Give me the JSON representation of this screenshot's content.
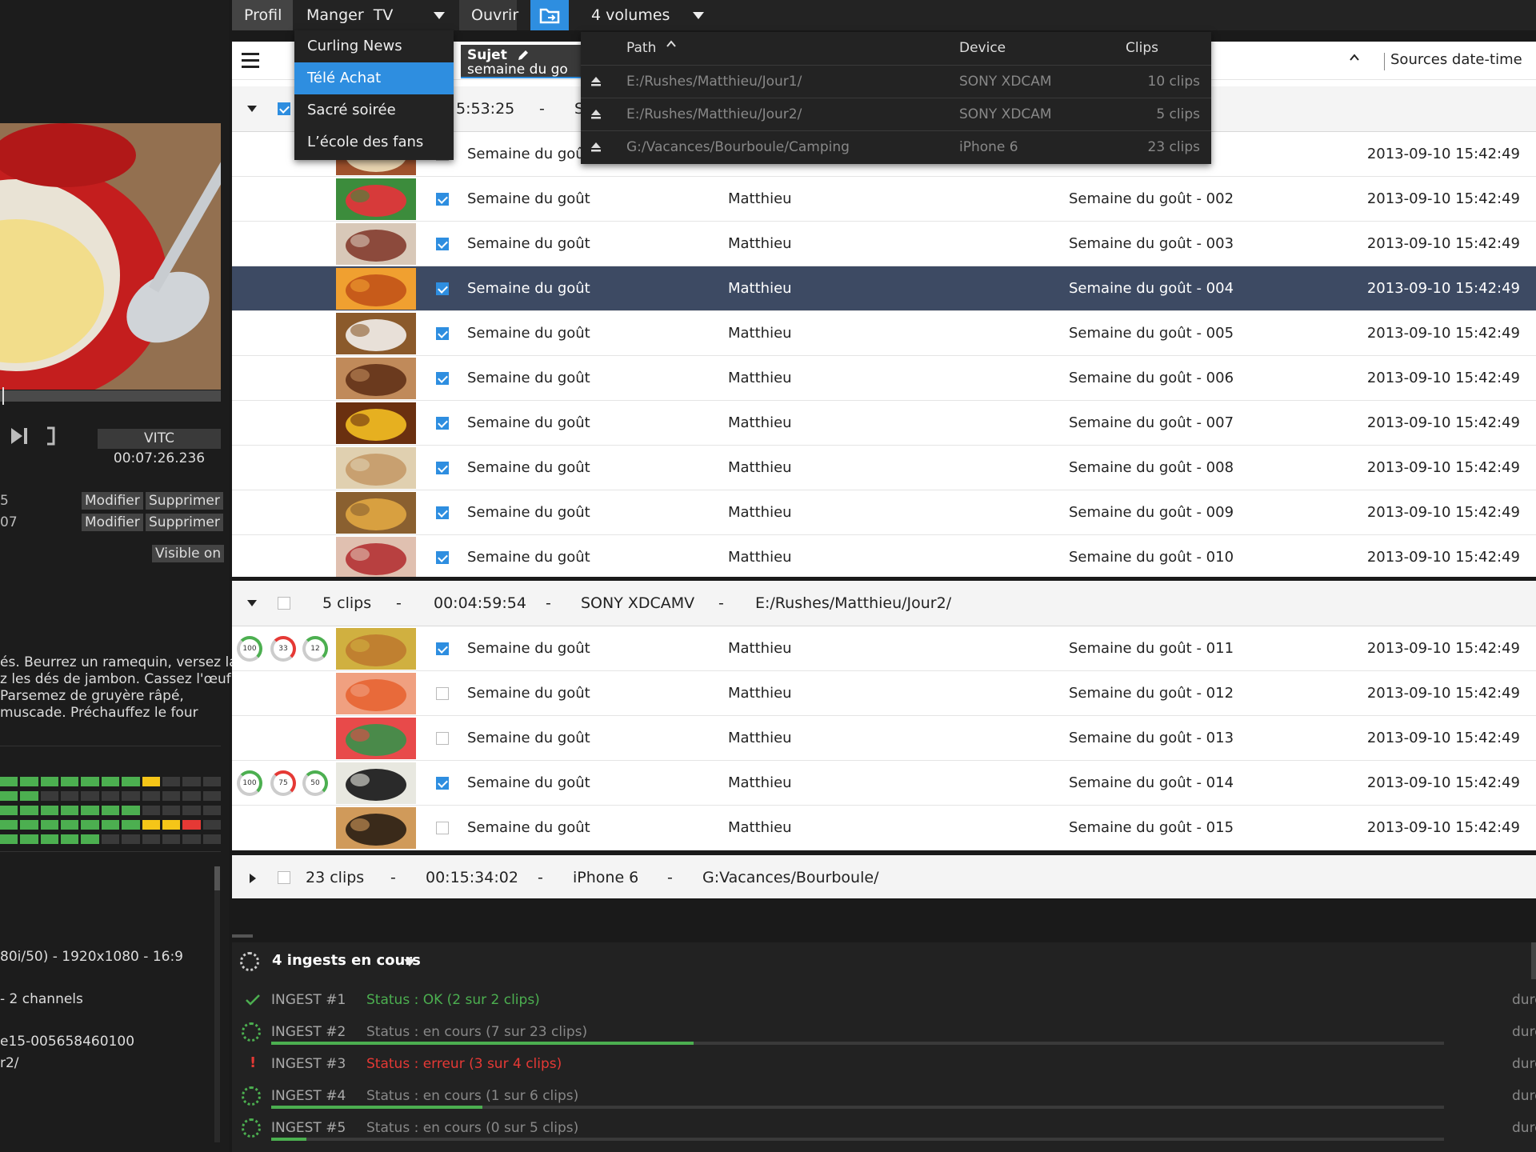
{
  "topbar": {
    "profil": "Profil",
    "profile_selected": "Manger  TV",
    "ouvrir": "Ouvrir",
    "volumes": "4 volumes"
  },
  "profile_menu": [
    "Curling News",
    "Télé Achat",
    "Sacré soirée",
    "L’école des fans"
  ],
  "profile_menu_active": 1,
  "volumes_panel": {
    "headers": {
      "path": "Path",
      "device": "Device",
      "clips": "Clips"
    },
    "rows": [
      {
        "path": "E:/Rushes/Matthieu/Jour1/",
        "device": "SONY XDCAM",
        "clips": "10 clips"
      },
      {
        "path": "E:/Rushes/Matthieu/Jour2/",
        "device": "SONY XDCAM",
        "clips": "5 clips"
      },
      {
        "path": "G:/Vacances/Bourboule/Camping",
        "device": "iPhone 6",
        "clips": "23 clips"
      }
    ]
  },
  "table_header": {
    "subject_label": "Sujet",
    "subject_value": "semaine du go",
    "sort_col": "Sources date-time"
  },
  "groups": [
    {
      "time_partial": "5:53:25",
      "dash": "-",
      "partial_letter": "S"
    },
    {
      "clips": "5 clips",
      "dash": "-",
      "duration": "00:04:59:54",
      "device": "SONY XDCAMV",
      "path": "E:/Rushes/Matthieu/Jour2/"
    },
    {
      "clips": "23 clips",
      "dash": "-",
      "duration": "00:15:34:02",
      "device": "iPhone 6",
      "path": "G:Vacances/Bourboule/"
    }
  ],
  "rows_group1": [
    {
      "subject": "Semaine du goût",
      "author": "",
      "name": "",
      "date": "2013-09-10 15:42:49",
      "checked": false
    },
    {
      "subject": "Semaine du goût",
      "author": "Matthieu",
      "name": "Semaine du goût - 002",
      "date": "2013-09-10 15:42:49",
      "checked": true
    },
    {
      "subject": "Semaine du goût",
      "author": "Matthieu",
      "name": "Semaine du goût - 003",
      "date": "2013-09-10 15:42:49",
      "checked": true
    },
    {
      "subject": "Semaine du goût",
      "author": "Matthieu",
      "name": "Semaine du goût - 004",
      "date": "2013-09-10 15:42:49",
      "checked": true
    },
    {
      "subject": "Semaine du goût",
      "author": "Matthieu",
      "name": "Semaine du goût - 005",
      "date": "2013-09-10 15:42:49",
      "checked": true
    },
    {
      "subject": "Semaine du goût",
      "author": "Matthieu",
      "name": "Semaine du goût - 006",
      "date": "2013-09-10 15:42:49",
      "checked": true
    },
    {
      "subject": "Semaine du goût",
      "author": "Matthieu",
      "name": "Semaine du goût - 007",
      "date": "2013-09-10 15:42:49",
      "checked": true
    },
    {
      "subject": "Semaine du goût",
      "author": "Matthieu",
      "name": "Semaine du goût - 008",
      "date": "2013-09-10 15:42:49",
      "checked": true
    },
    {
      "subject": "Semaine du goût",
      "author": "Matthieu",
      "name": "Semaine du goût - 009",
      "date": "2013-09-10 15:42:49",
      "checked": true
    },
    {
      "subject": "Semaine du goût",
      "author": "Matthieu",
      "name": "Semaine du goût - 010",
      "date": "2013-09-10 15:42:49",
      "checked": true
    }
  ],
  "rows_group2": [
    {
      "subject": "Semaine du goût",
      "author": "Matthieu",
      "name": "Semaine du goût - 011",
      "date": "2013-09-10 15:42:49",
      "checked": true,
      "rings": [
        "100",
        "33",
        "12"
      ]
    },
    {
      "subject": "Semaine du goût",
      "author": "Matthieu",
      "name": "Semaine du goût - 012",
      "date": "2013-09-10 15:42:49",
      "checked": false
    },
    {
      "subject": "Semaine du goût",
      "author": "Matthieu",
      "name": "Semaine du goût - 013",
      "date": "2013-09-10 15:42:49",
      "checked": false
    },
    {
      "subject": "Semaine du goût",
      "author": "Matthieu",
      "name": "Semaine du goût - 014",
      "date": "2013-09-10 15:42:49",
      "checked": true,
      "rings": [
        "100",
        "75",
        "50"
      ]
    },
    {
      "subject": "Semaine du goût",
      "author": "Matthieu",
      "name": "Semaine du goût - 015",
      "date": "2013-09-10 15:42:49",
      "checked": false
    }
  ],
  "left": {
    "vitc": "VITC 00:07:26.236",
    "marker1_num": "5",
    "marker2_num": "07",
    "modifier": "Modifier",
    "supprimer": "Supprimer",
    "visible_on": "Visible on",
    "desc_lines": [
      "és. Beurrez un ramequin, versez la",
      "z les dés de jambon. Cassez l'œuf",
      "Parsemez de gruyère râpé,",
      "muscade. Préchauffez le four"
    ],
    "info_lines": [
      "80i/50) - 1920x1080 - 16:9",
      " - 2 channels",
      "e15-005658460100",
      "r2/"
    ]
  },
  "ingest": {
    "title": "4 ingests en cours",
    "trailing": "dure",
    "rows": [
      {
        "name": "INGEST #1",
        "status": "Status : OK (2 sur 2 clips)",
        "state": "ok",
        "progress": 1.0
      },
      {
        "name": "INGEST #2",
        "status": "Status : en cours (7 sur 23 clips)",
        "state": "running",
        "progress": 0.36
      },
      {
        "name": "INGEST #3",
        "status": "Status : erreur (3 sur 4 clips)",
        "state": "error",
        "progress": 0
      },
      {
        "name": "INGEST #4",
        "status": "Status : en cours (1 sur 6 clips)",
        "state": "running",
        "progress": 0.18
      },
      {
        "name": "INGEST #5",
        "status": "Status : en cours (0 sur 5 clips)",
        "state": "running",
        "progress": 0.03
      }
    ]
  },
  "colors": {
    "accent": "#2e8ee0",
    "ok": "#4caf50",
    "error": "#e53935",
    "warn": "#f5c518",
    "selected_row": "#3d4a63"
  }
}
